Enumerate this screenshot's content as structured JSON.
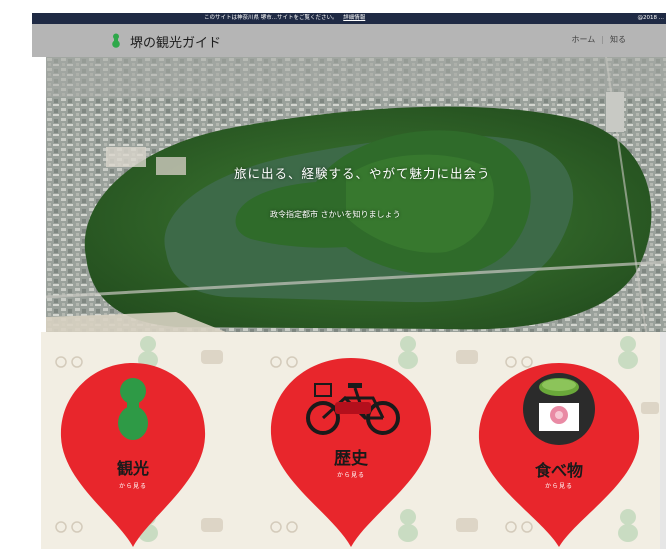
{
  "notice": {
    "text": "このサイトは神奈川県 堺市...サイトをご覧ください。",
    "link": "詳細情報",
    "right": "@2018 ..."
  },
  "header": {
    "title": "堺の観光ガイド",
    "nav": [
      "ホーム",
      "知る"
    ]
  },
  "hero": {
    "title": "旅に出る、経験する、やがて魅力に出会う",
    "subtitle": "政令指定都市 さかいを知りましょう"
  },
  "categories": [
    {
      "label": "観光",
      "sub": "から見る",
      "icon": "haniwa-keyhole-icon"
    },
    {
      "label": "歴史",
      "sub": "から見る",
      "icon": "bicycle-icon"
    },
    {
      "label": "食べ物",
      "sub": "から見る",
      "icon": "tea-sweets-icon"
    }
  ],
  "colors": {
    "pin_red": "#e8262c",
    "header_gray": "#b5b5b5",
    "notice_bar": "#1f2a44",
    "pattern_bg": "#f2eee3",
    "forest_green": "#2f6b2a",
    "moat_green": "#3d6a48"
  }
}
